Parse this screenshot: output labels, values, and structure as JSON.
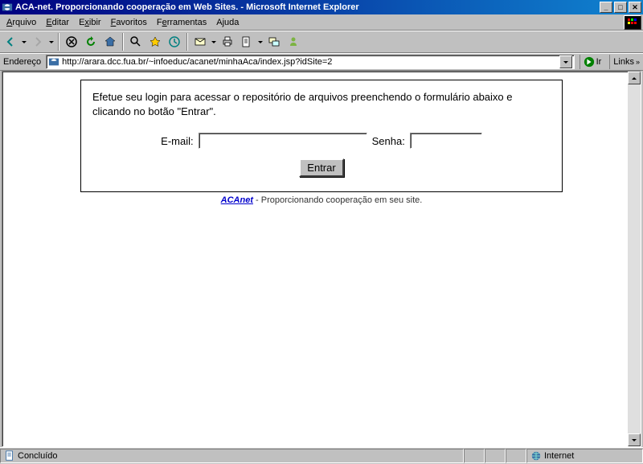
{
  "window": {
    "title": "ACA-net. Proporcionando cooperação em Web Sites. - Microsoft Internet Explorer"
  },
  "menu": {
    "items": [
      "Arquivo",
      "Editar",
      "Exibir",
      "Favoritos",
      "Ferramentas",
      "Ajuda"
    ]
  },
  "address": {
    "label": "Endereço",
    "url": "http://arara.dcc.fua.br/~infoeduc/acanet/minhaAca/index.jsp?idSite=2",
    "go": "Ir",
    "links": "Links"
  },
  "login": {
    "intro": "Efetue seu login para acessar o repositório de arquivos preenchendo o formulário abaixo e clicando no botão \"Entrar\".",
    "email_label": "E-mail:",
    "senha_label": "Senha:",
    "submit": "Entrar",
    "email_value": "",
    "senha_value": ""
  },
  "footer": {
    "brand": "ACAnet",
    "tagline": " - Proporcionando cooperação em seu site."
  },
  "status": {
    "text": "Concluído",
    "zone": "Internet"
  }
}
